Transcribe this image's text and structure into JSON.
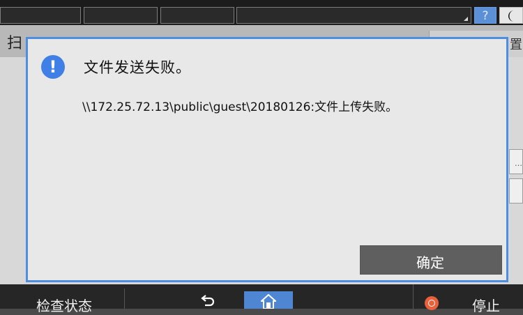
{
  "topbar": {
    "help_label": "?",
    "icons": [
      "help-icon",
      "moon-icon"
    ]
  },
  "background": {
    "title_fragment": "扫",
    "tab_label": "置"
  },
  "dialog": {
    "icon": "exclamation-icon",
    "icon_glyph": "!",
    "title": "文件发送失败。",
    "message": "\\\\172.25.72.13\\public\\guest\\20180126:文件上传失败。",
    "ok_label": "确定",
    "accent_color": "#4d8ee0"
  },
  "bottombar": {
    "check_status_label": "检查状态",
    "stop_label": "停止",
    "icons": [
      "back-arrow-icon",
      "home-icon",
      "stop-icon"
    ]
  }
}
